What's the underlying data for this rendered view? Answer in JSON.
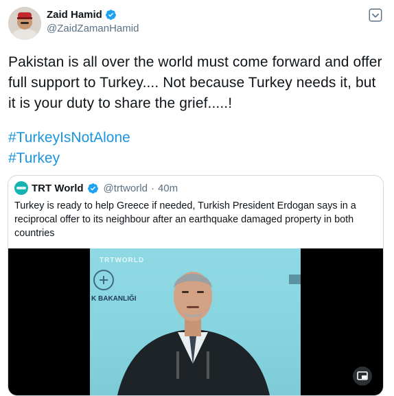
{
  "author": {
    "display_name": "Zaid Hamid",
    "handle": "@ZaidZamanHamid",
    "verified": true
  },
  "tweet": {
    "text": "Pakistan is all over the world must come forward and offer full support to Turkey.... Not because Turkey needs it, but it is your duty to share the grief.....!",
    "hashtags": [
      "#TurkeyIsNotAlone",
      "#Turkey"
    ]
  },
  "quoted_tweet": {
    "display_name": "TRT World",
    "handle": "@trtworld",
    "separator": "·",
    "time": "40m",
    "verified": true,
    "text": "Turkey is ready to help Greece if needed, Turkish President Erdogan says in a reciprocal offer to its neighbour after an earthquake damaged property in both countries",
    "media": {
      "type": "video",
      "watermark": "TRTWORLD",
      "background_text": "K BAKANLIĞI"
    }
  },
  "icons": {
    "more": "chevron-down-icon",
    "verified": "verified-badge-icon",
    "media_control": "picture-in-picture-icon"
  },
  "colors": {
    "accent": "#1b95e0",
    "text": "#0f1419",
    "secondary": "#5b7083",
    "border": "#cfd9de",
    "trt": "#17b3b0"
  }
}
